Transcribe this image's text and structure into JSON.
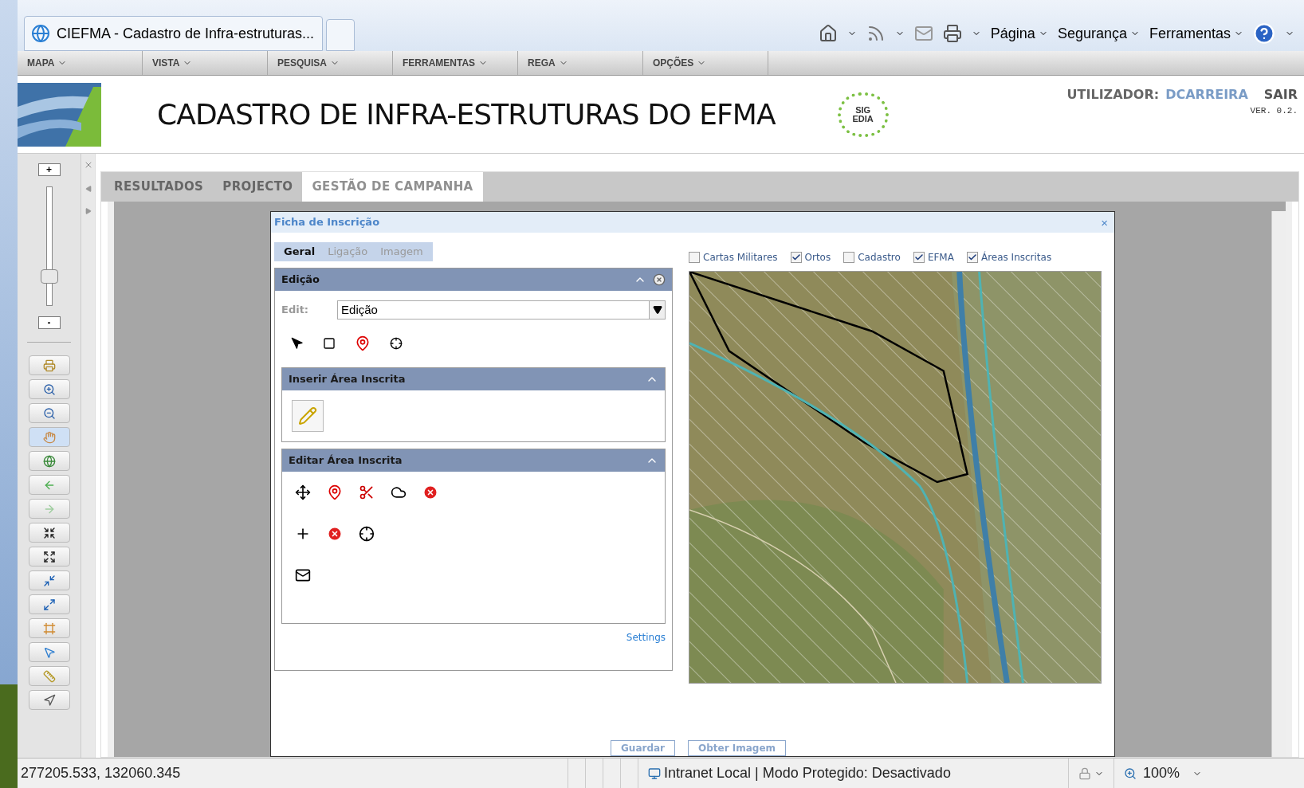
{
  "browser": {
    "tab_title": "CIEFMA - Cadastro de Infra-estruturas...",
    "commands": [
      "Página",
      "Segurança",
      "Ferramentas"
    ]
  },
  "menu": [
    "MAPA",
    "VISTA",
    "PESQUISA",
    "FERRAMENTAS",
    "REGA",
    "OPÇÕES"
  ],
  "header": {
    "title": "CADASTRO DE INFRA-ESTRUTURAS DO EFMA",
    "logo_text": [
      "SIG",
      "EDIA"
    ],
    "user_label": "UTILIZADOR:",
    "user": "DCARREIRA",
    "logout": "SAIR",
    "version": "VER. 0.2."
  },
  "zoom": {
    "plus": "+",
    "minus": "-",
    "level": 0.25
  },
  "map_tools": [
    {
      "kind": "print",
      "selected": false
    },
    {
      "kind": "zoom_in",
      "selected": false
    },
    {
      "kind": "zoom_out",
      "selected": false
    },
    {
      "kind": "pan",
      "selected": true
    },
    {
      "kind": "globe",
      "selected": false
    },
    {
      "kind": "back",
      "selected": false
    },
    {
      "kind": "forward",
      "selected": false
    },
    {
      "kind": "shrink",
      "selected": false
    },
    {
      "kind": "expand",
      "selected": false
    },
    {
      "kind": "shrink_box",
      "selected": false
    },
    {
      "kind": "expand_box",
      "selected": false
    },
    {
      "kind": "frame",
      "selected": false
    },
    {
      "kind": "xy_pick",
      "selected": false
    },
    {
      "kind": "measure",
      "selected": false
    },
    {
      "kind": "xy_go",
      "selected": false
    }
  ],
  "main_tabs": [
    {
      "label": "RESULTADOS",
      "selected": false
    },
    {
      "label": "PROJECTO",
      "selected": false
    },
    {
      "label": "GESTÃO DE CAMPANHA",
      "selected": true
    }
  ],
  "dialog": {
    "title": "Ficha de Inscrição",
    "close": "×",
    "tabs": [
      {
        "label": "Geral",
        "selected": true
      },
      {
        "label": "Ligação",
        "selected": false
      },
      {
        "label": "Imagem",
        "selected": false
      }
    ],
    "panel": {
      "title": "Edição",
      "edit_label": "Edit:",
      "edit_value": "Edição",
      "sections": [
        {
          "kind": "insert",
          "title": "Inserir Área Inscrita"
        },
        {
          "kind": "edit",
          "title": "Editar Área Inscrita"
        }
      ],
      "settings": "Settings"
    },
    "layers": [
      {
        "label": "Cartas Militares",
        "checked": false
      },
      {
        "label": "Ortos",
        "checked": true
      },
      {
        "label": "Cadastro",
        "checked": false
      },
      {
        "label": "EFMA",
        "checked": true
      },
      {
        "label": "Áreas Inscritas",
        "checked": true
      }
    ],
    "buttons": [
      "Guardar",
      "Obter Imagem"
    ]
  },
  "status_bar": {
    "coordinates": "277205.533, 132060.345",
    "zone": "Intranet Local | Modo Protegido: Desactivado",
    "zoom": "100%"
  }
}
